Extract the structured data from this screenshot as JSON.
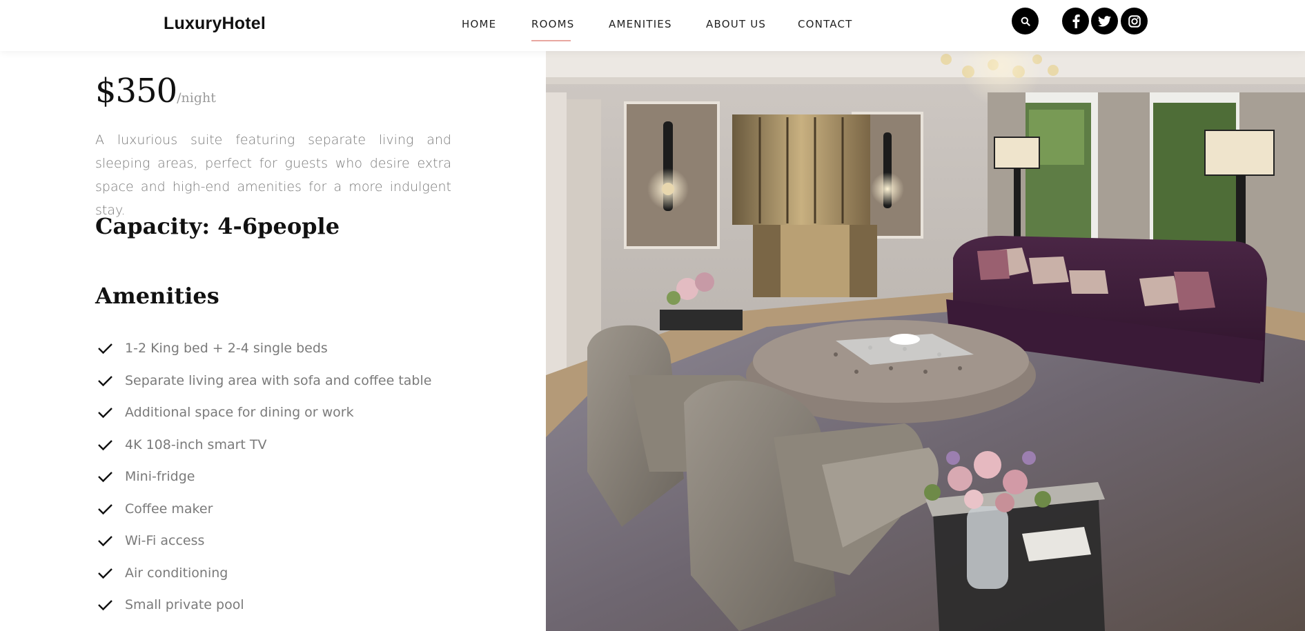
{
  "header": {
    "logo": "LuxuryHotel",
    "nav": [
      {
        "label": "HOME",
        "active": false
      },
      {
        "label": "ROOMS",
        "active": true
      },
      {
        "label": "AMENITIES",
        "active": false
      },
      {
        "label": "ABOUT US",
        "active": false
      },
      {
        "label": "CONTACT",
        "active": false
      }
    ],
    "search_icon": "search-icon",
    "social_icons": [
      "facebook-icon",
      "twitter-icon",
      "instagram-icon"
    ],
    "active_underline_color": "#e8a7a0"
  },
  "room": {
    "price": "$350",
    "per": "/night",
    "description": "A luxurious suite featuring separate living and sleeping areas, perfect for guests who desire extra space and high-end amenities for a more indulgent stay.",
    "capacity": "Capacity: 4-6people"
  },
  "amenities": {
    "title": "Amenities",
    "check_icon": "check-icon",
    "items": [
      "1-2 King bed + 2-4 single beds",
      "Separate living area with sofa and coffee table",
      "Additional space for dining or work",
      "4K 108-inch smart TV",
      "Mini-fridge",
      "Coffee maker",
      "Wi-Fi access",
      "Air conditioning",
      "Small private pool"
    ]
  },
  "photo": {
    "subject": "suite-living-room-photo"
  }
}
